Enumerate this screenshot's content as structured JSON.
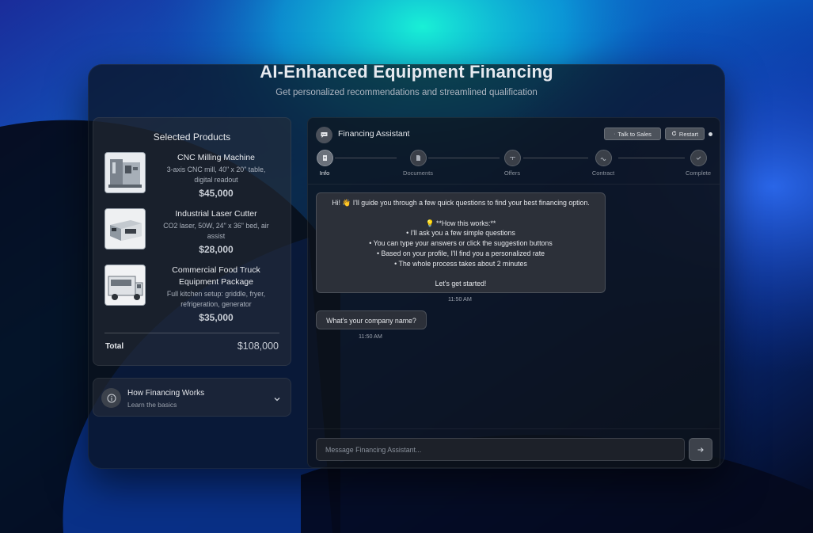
{
  "hero": {
    "title": "AI-Enhanced Equipment Financing",
    "subtitle": "Get personalized recommendations and streamlined qualification"
  },
  "products": {
    "title": "Selected Products",
    "items": [
      {
        "name": "CNC Milling Machine",
        "desc_lines": [
          "3-axis CNC mill, 40\" x 20\" table,",
          "digital readout"
        ],
        "price": "$45,000",
        "icon": "cnc-mill-photo"
      },
      {
        "name": "Industrial Laser Cutter",
        "desc_lines": [
          "CO2 laser, 50W, 24\" x 36\" bed, air",
          "assist"
        ],
        "price": "$28,000",
        "icon": "laser-cutter-photo"
      },
      {
        "name_lines": [
          "Commercial Food Truck",
          "Equipment Package"
        ],
        "desc_lines": [
          "Full kitchen setup: griddle, fryer,",
          "refrigeration, generator"
        ],
        "price": "$35,000",
        "icon": "food-truck-photo"
      }
    ],
    "total_label": "Total",
    "total_value": "$108,000"
  },
  "how_it_works": {
    "title": "How Financing Works",
    "subtitle": "Learn the basics"
  },
  "assistant": {
    "title": "Financing Assistant",
    "talk_to_sales": "Talk to Sales",
    "restart": "Restart",
    "steps": [
      {
        "label": "Info",
        "active": true
      },
      {
        "label": "Documents",
        "active": false
      },
      {
        "label": "Offers",
        "active": false
      },
      {
        "label": "Contract",
        "active": false
      },
      {
        "label": "Complete",
        "active": false
      }
    ],
    "messages": {
      "welcome_lines": [
        "Hi! 👋 I'll guide you through a few quick questions to find your best financing option.",
        "",
        "💡 **How this works:**",
        "• I'll ask you a few simple questions",
        "• You can type your answers or click the suggestion buttons",
        "• Based on your profile, I'll find you a personalized rate",
        "• The whole process takes about 2 minutes",
        "",
        "Let's get started!"
      ],
      "welcome_time": "11:50 AM",
      "question": "What's your company name?",
      "question_time": "11:50 AM"
    },
    "composer_placeholder": "Message Financing Assistant..."
  }
}
